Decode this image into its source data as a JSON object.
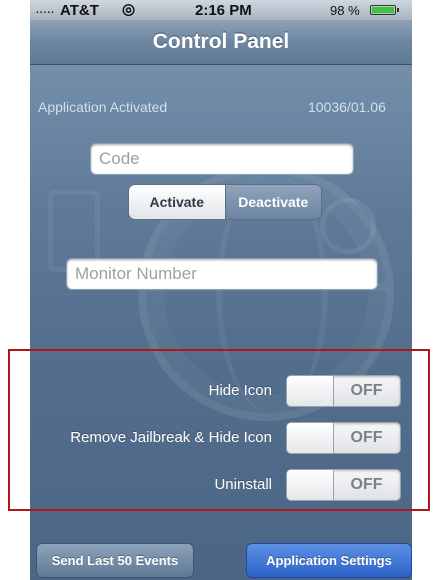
{
  "status_bar": {
    "signal": ".....",
    "carrier": "AT&T",
    "wifi_icon": "wifi-icon",
    "time": "2:16 PM",
    "battery_percent": "98 %",
    "battery_level": 0.98,
    "battery_color": "#3cc63c"
  },
  "nav": {
    "title": "Control Panel"
  },
  "status": {
    "left": "Application Activated",
    "right": "10036/01.06"
  },
  "code_field": {
    "value": "",
    "placeholder": "Code"
  },
  "activation": {
    "activate_label": "Activate",
    "deactivate_label": "Deactivate",
    "selected": "Activate"
  },
  "monitor_field": {
    "value": "",
    "placeholder": "Monitor Number"
  },
  "settings": [
    {
      "label": "Hide Icon",
      "state": "OFF"
    },
    {
      "label": "Remove Jailbreak & Hide Icon",
      "state": "OFF"
    },
    {
      "label": "Uninstall",
      "state": "OFF"
    }
  ],
  "bottom": {
    "send_events_label": "Send Last 50 Events",
    "app_settings_label": "Application Settings"
  },
  "colors": {
    "background": "#5f7b99",
    "highlight": "#b01818",
    "primary_button": "#2d63c9"
  }
}
